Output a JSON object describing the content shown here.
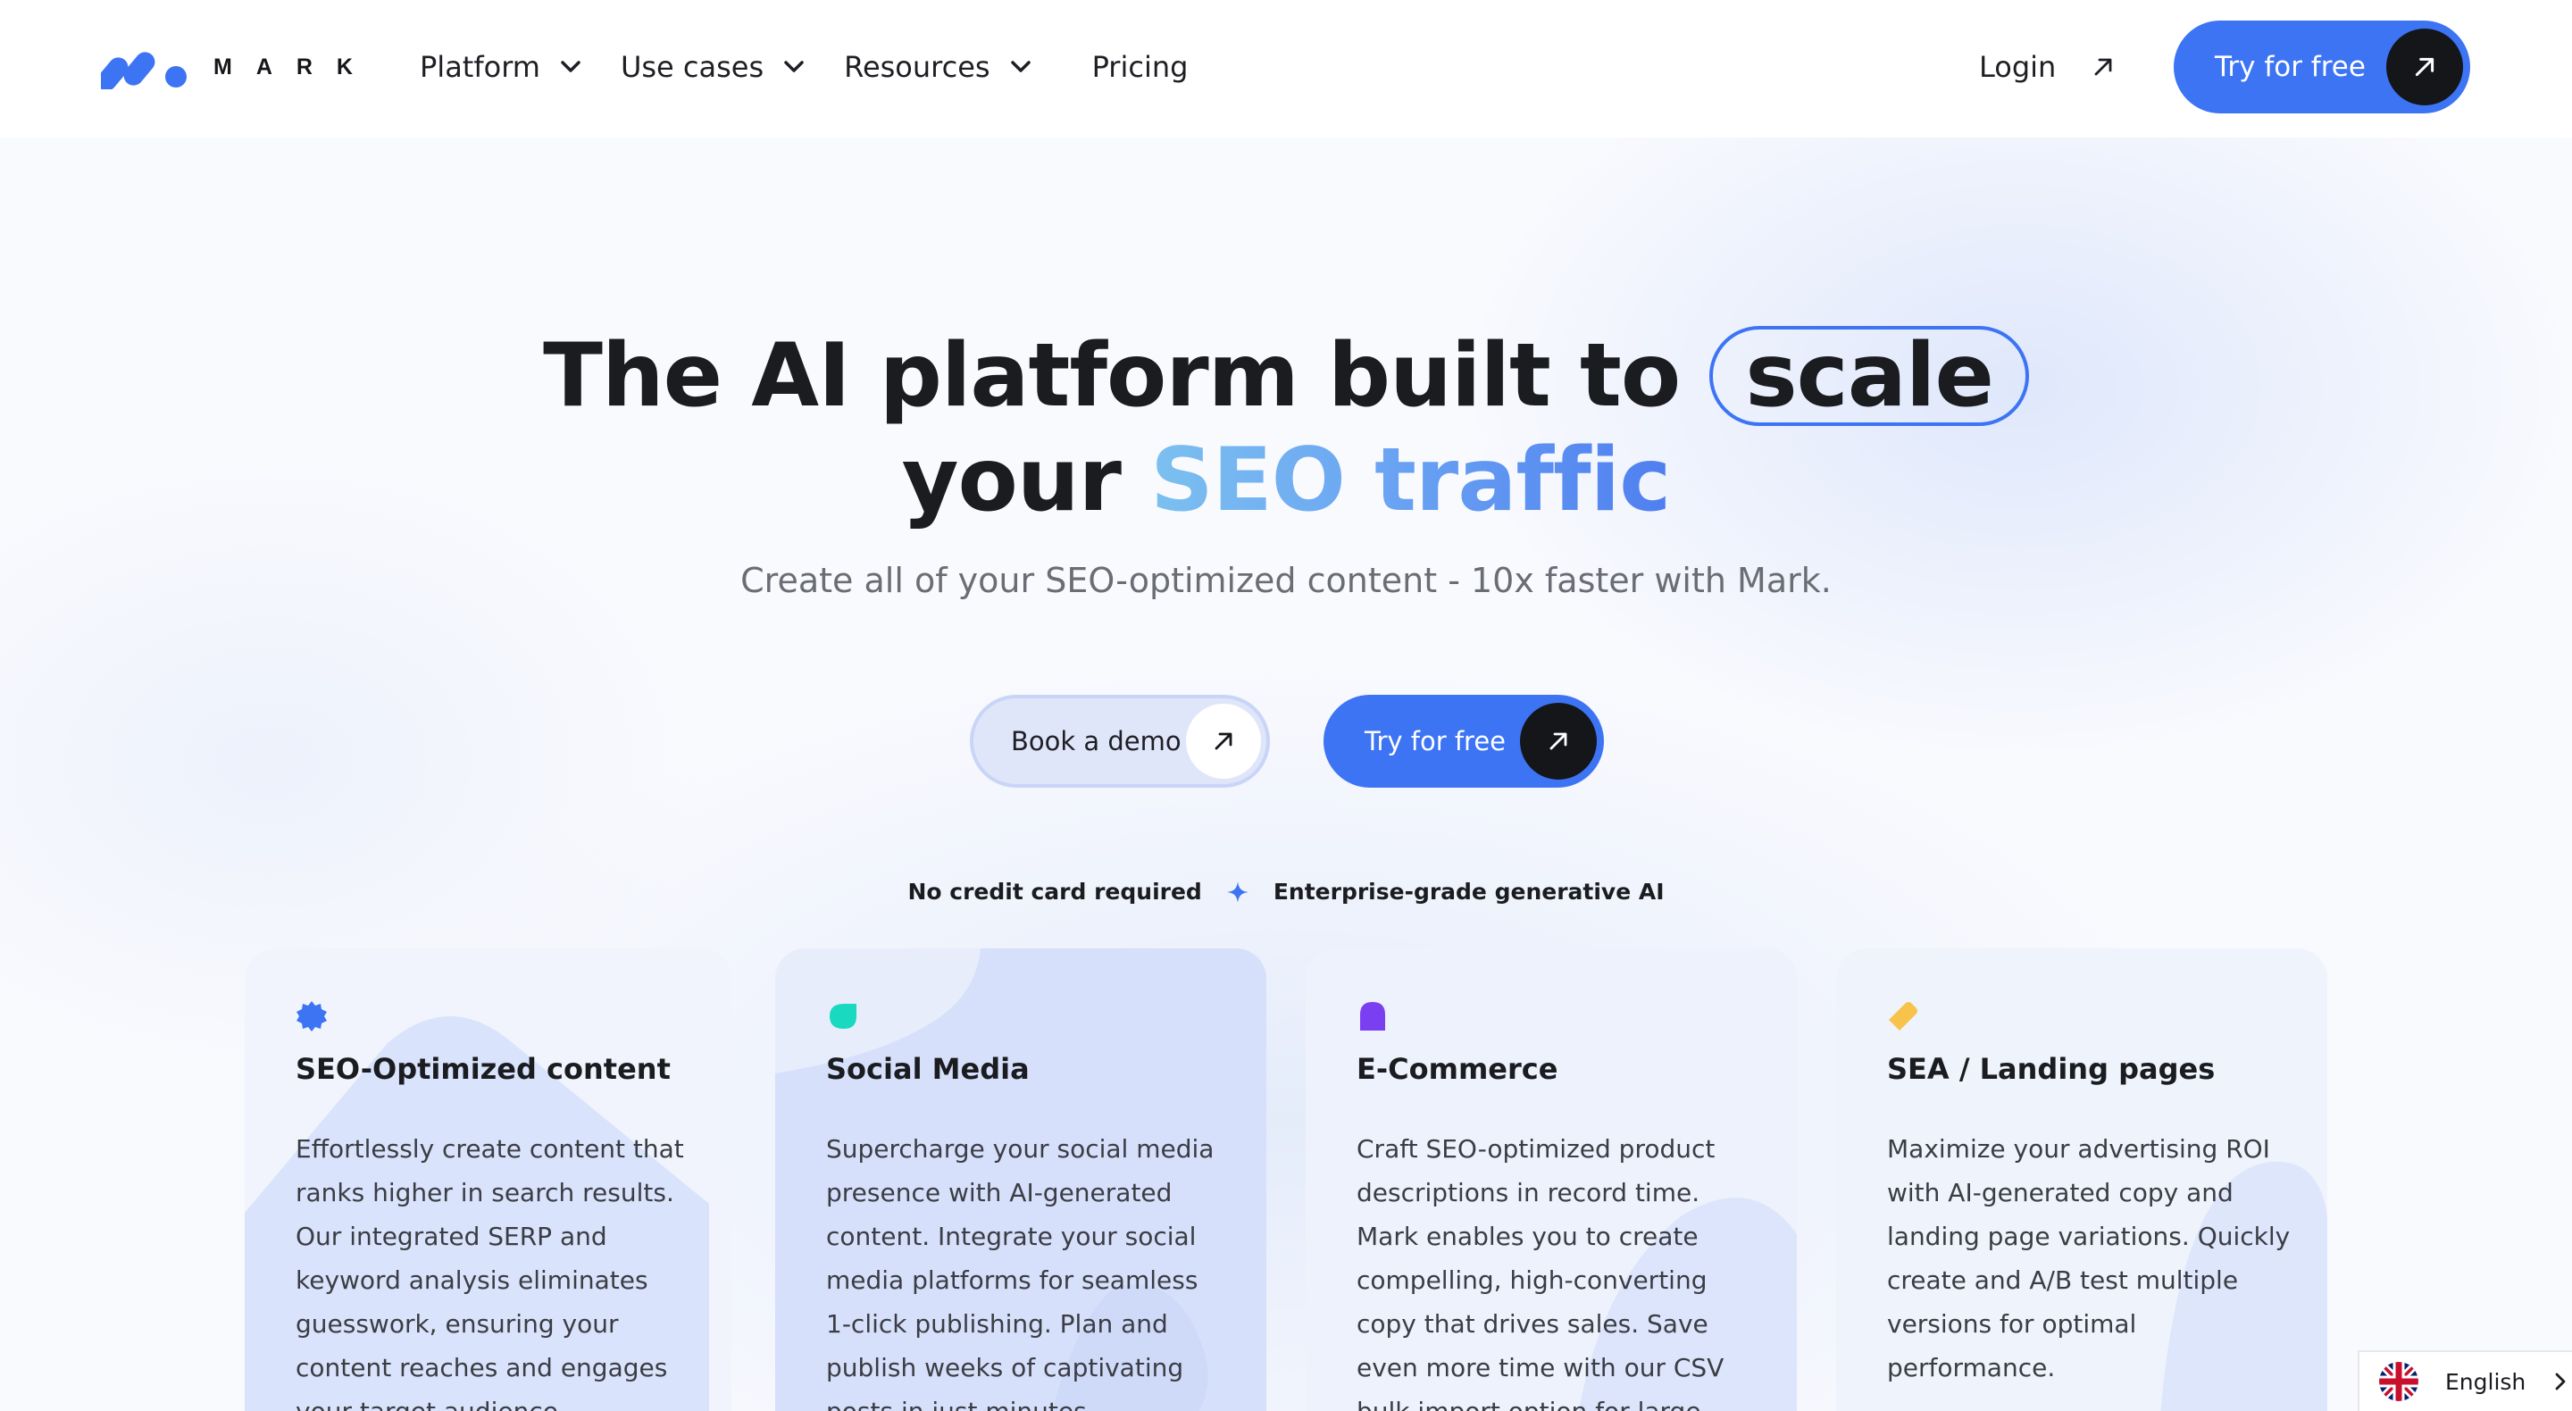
{
  "nav": {
    "logo_text": "MARK",
    "links": [
      {
        "label": "Platform"
      },
      {
        "label": "Use cases"
      },
      {
        "label": "Resources"
      }
    ],
    "pricing": "Pricing",
    "login": "Login",
    "cta": "Try for free"
  },
  "hero": {
    "headline_part1": "The AI platform built to",
    "headline_pill": "scale",
    "headline_part2": "your",
    "headline_gradient": "SEO traffic",
    "subtitle": "Create all of your SEO-optimized content - 10x faster with Mark.",
    "demo_button": "Book a demo",
    "cta_button": "Try for free",
    "badge_left": "No credit card required",
    "badge_right": "Enterprise-grade generative AI"
  },
  "cards": [
    {
      "title": "SEO-Optimized content",
      "text": "Effortlessly create content that ranks higher in search results. Our integrated SERP and keyword analysis eliminates guesswork, ensuring your content reaches and engages your target audience.",
      "icon": "badge-icon",
      "icon_color": "#3d74f4"
    },
    {
      "title": "Social Media",
      "text": "Supercharge your social media presence with AI-generated content. Integrate your social media platforms for seamless 1-click publishing. Plan and publish weeks of captivating posts in just minutes.",
      "icon": "leaf-icon",
      "icon_color": "#19d9c0"
    },
    {
      "title": "E-Commerce",
      "text": "Craft SEO-optimized product descriptions in record time. Mark enables you to create compelling, high-converting copy that drives sales. Save even more time with our CSV bulk import option for large-scale content generation.",
      "icon": "arch-icon",
      "icon_color": "#7b3ff2"
    },
    {
      "title": "SEA / Landing pages",
      "text": "Maximize your advertising ROI with AI-generated copy and landing page variations. Quickly create and A/B test multiple versions for optimal performance.",
      "icon": "tag-icon",
      "icon_color": "#f7c34a"
    }
  ],
  "language": {
    "label": "English",
    "flag": "uk-flag-icon"
  },
  "colors": {
    "accent": "#3d74f4",
    "dark": "#15161a"
  }
}
